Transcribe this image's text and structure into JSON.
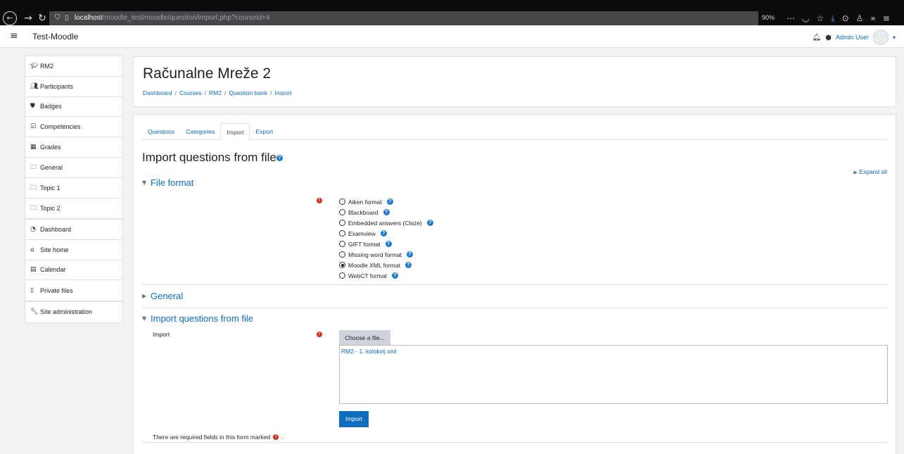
{
  "browser": {
    "url_host": "localhost",
    "url_path": "/moodle_test/moodle/question/import.php?courseid=4",
    "zoom": "90%"
  },
  "navbar": {
    "site_name": "Test-Moodle",
    "user_name": "Admin User"
  },
  "drawer": {
    "course_items": [
      {
        "label": "RM2",
        "icon": "graduation-cap-icon"
      },
      {
        "label": "Participants",
        "icon": "users-icon"
      },
      {
        "label": "Badges",
        "icon": "shield-icon"
      },
      {
        "label": "Competencies",
        "icon": "checkbox-icon"
      },
      {
        "label": "Grades",
        "icon": "table-icon"
      },
      {
        "label": "General",
        "icon": "folder-icon"
      },
      {
        "label": "Topic 1",
        "icon": "folder-icon"
      },
      {
        "label": "Topic 2",
        "icon": "folder-icon"
      }
    ],
    "site_items": [
      {
        "label": "Dashboard",
        "icon": "dashboard-icon"
      },
      {
        "label": "Site home",
        "icon": "home-icon"
      },
      {
        "label": "Calendar",
        "icon": "calendar-icon"
      },
      {
        "label": "Private files",
        "icon": "file-icon"
      }
    ],
    "admin_items": [
      {
        "label": "Site administration",
        "icon": "wrench-icon"
      }
    ]
  },
  "header": {
    "course_title": "Računalne Mreže 2",
    "breadcrumb": [
      "Dashboard",
      "Courses",
      "RM2",
      "Question bank",
      "Import"
    ]
  },
  "tabs": [
    "Questions",
    "Categories",
    "Import",
    "Export"
  ],
  "active_tab": "Import",
  "page_heading": "Import questions from file",
  "expand_all": "Expand all",
  "sections": {
    "file_format": "File format",
    "general": "General",
    "import_file": "Import questions from file"
  },
  "formats": [
    {
      "label": "Aiken format",
      "checked": false
    },
    {
      "label": "Blackboard",
      "checked": false
    },
    {
      "label": "Embedded answers (Cloze)",
      "checked": false
    },
    {
      "label": "Examview",
      "checked": false
    },
    {
      "label": "GIFT format",
      "checked": false
    },
    {
      "label": "Missing word format",
      "checked": false
    },
    {
      "label": "Moodle XML format",
      "checked": true
    },
    {
      "label": "WebCT format",
      "checked": false
    }
  ],
  "import_field": {
    "label": "Import",
    "choose_label": "Choose a file...",
    "file_name": "RM2 - 1. kolokvij.xml"
  },
  "import_button": "Import",
  "required_note": "There are required fields in this form marked",
  "required_note_end": ".",
  "colors": {
    "link": "#0f6cbf",
    "required": "#ca3120",
    "help": "#1f7aca",
    "primary_button": "#0f6cbf"
  }
}
